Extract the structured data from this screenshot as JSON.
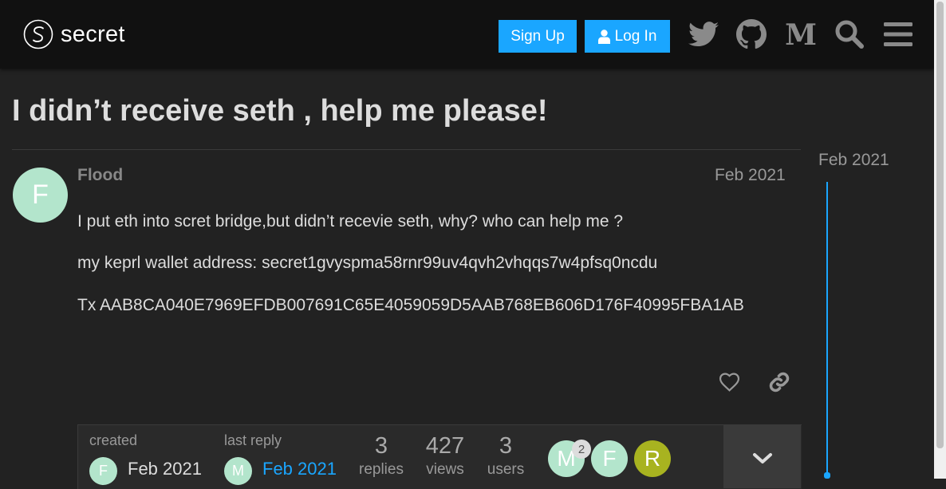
{
  "header": {
    "brand": "secret",
    "signup_label": "Sign Up",
    "login_label": "Log In",
    "icons": [
      "twitter-icon",
      "github-icon",
      "medium-icon",
      "search-icon",
      "hamburger-menu-icon"
    ]
  },
  "topic": {
    "title": "I didn’t receive seth , help me please!"
  },
  "post": {
    "avatar_letter": "F",
    "author": "Flood",
    "date": "Feb 2021",
    "paragraphs": [
      "I put eth into scret bridge,but didn’t recevie seth, why? who can help me ?",
      "my keprl wallet address: secret1gvyspma58rnr99uv4qvh2vhqqs7w4pfsq0ncdu",
      "Tx AAB8CA040E7969EFDB007691C65E4059059D5AAB768EB606D176F40995FBA1AB"
    ]
  },
  "summary": {
    "created_label": "created",
    "created_avatar": "F",
    "created_date": "Feb 2021",
    "last_reply_label": "last reply",
    "last_reply_avatar": "M",
    "last_reply_date": "Feb 2021",
    "stats": [
      {
        "value": "3",
        "label": "replies"
      },
      {
        "value": "427",
        "label": "views"
      },
      {
        "value": "3",
        "label": "users"
      }
    ],
    "users": [
      {
        "letter": "M",
        "color": "#b3e5cc"
      },
      {
        "letter": "F",
        "color": "#b3e5cc"
      },
      {
        "letter": "R",
        "color": "#a8b320"
      }
    ],
    "user_badge": "2"
  },
  "timeline": {
    "date": "Feb 2021"
  },
  "colors": {
    "accent": "#1aa6ff",
    "header_bg": "#111111",
    "page_bg": "#222222",
    "avatar_mint": "#b3e5cc",
    "avatar_olive": "#a8b320"
  }
}
